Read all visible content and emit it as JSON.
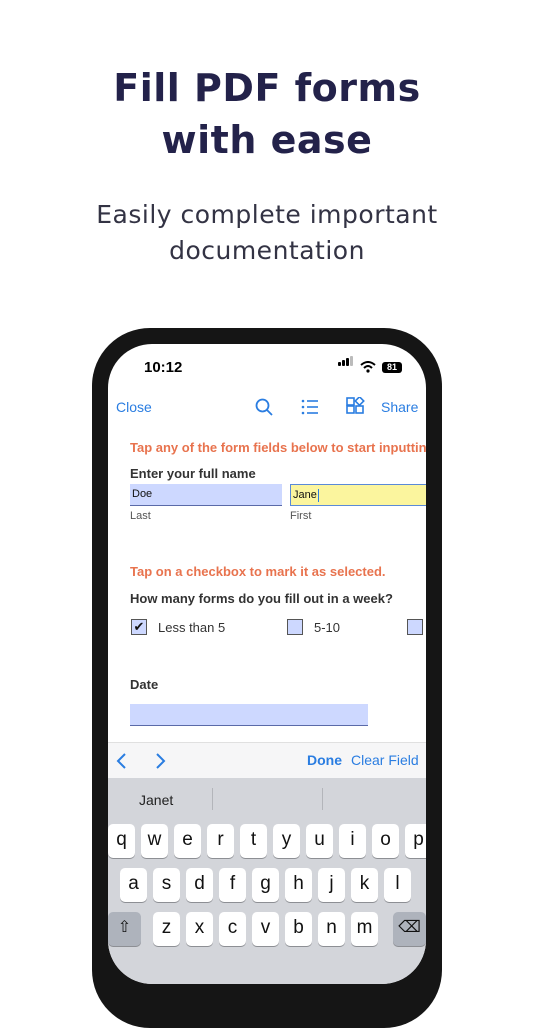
{
  "headline": {
    "line1": "Fill PDF forms",
    "line2": "with ease"
  },
  "subheadline": {
    "line1": "Easily complete important",
    "line2": "documentation"
  },
  "status_bar": {
    "time": "10:12",
    "battery": "81"
  },
  "toolbar": {
    "close_label": "Close",
    "share_label": "Share",
    "icons": [
      "search-icon",
      "outline-list-icon",
      "thumbnails-grid-icon"
    ]
  },
  "document": {
    "instruction1": "Tap any of the form fields below to start inputting",
    "name_label": "Enter your full name",
    "last_value": "Doe",
    "last_caption": "Last",
    "first_value": "Jane",
    "first_caption": "First",
    "instruction2": "Tap on a checkbox to mark it as selected.",
    "question": "How many forms do you fill out in a week?",
    "options": [
      {
        "label": "Less than 5",
        "checked": true
      },
      {
        "label": "5-10",
        "checked": false
      },
      {
        "label": "",
        "checked": false
      }
    ],
    "checkmark": "✔",
    "date_label": "Date",
    "date_value": ""
  },
  "accessory_bar": {
    "prev_icon": "chevron-left-icon",
    "next_icon": "chevron-right-icon",
    "done_label": "Done",
    "clear_label": "Clear Field"
  },
  "keyboard": {
    "suggestions": [
      "Janet",
      "",
      ""
    ],
    "row1": [
      "q",
      "w",
      "e",
      "r",
      "t",
      "y",
      "u",
      "i",
      "o",
      "p"
    ],
    "row2": [
      "a",
      "s",
      "d",
      "f",
      "g",
      "h",
      "j",
      "k",
      "l"
    ],
    "row3": [
      "z",
      "x",
      "c",
      "v",
      "b",
      "n",
      "m"
    ],
    "shift_icon": "shift-icon",
    "delete_icon": "delete-icon"
  },
  "colors": {
    "accent": "#2a7de1",
    "instruction": "#e8734e",
    "field": "#cdd8ff",
    "active_field": "#fbf59e",
    "headline": "#23224a"
  }
}
